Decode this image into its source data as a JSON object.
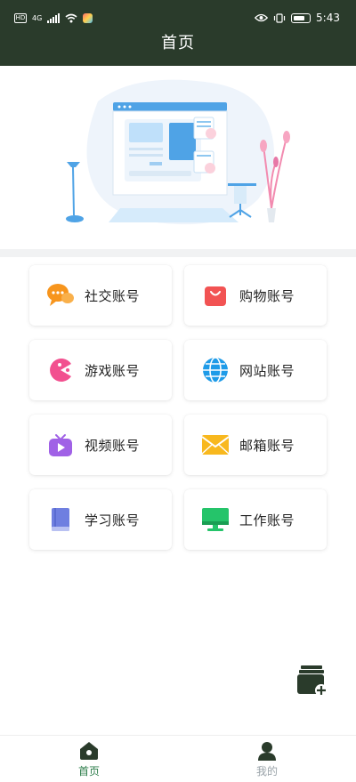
{
  "status_bar": {
    "hd": "HD",
    "network": "4G",
    "time": "5:43"
  },
  "header": {
    "title": "首页"
  },
  "categories": [
    {
      "label": "社交账号",
      "icon": "chat-bubbles-icon",
      "color": "#f7951d"
    },
    {
      "label": "购物账号",
      "icon": "shopping-bag-icon",
      "color": "#f25353"
    },
    {
      "label": "游戏账号",
      "icon": "pacman-icon",
      "color": "#f2508f"
    },
    {
      "label": "网站账号",
      "icon": "globe-icon",
      "color": "#1e9be8"
    },
    {
      "label": "视频账号",
      "icon": "tv-play-icon",
      "color": "#a061e6"
    },
    {
      "label": "邮箱账号",
      "icon": "mail-envelope-icon",
      "color": "#f8b81e"
    },
    {
      "label": "学习账号",
      "icon": "book-icon",
      "color": "#6f7fe0"
    },
    {
      "label": "工作账号",
      "icon": "monitor-icon",
      "color": "#25c46a"
    }
  ],
  "bottom_nav": {
    "home": {
      "label": "首页",
      "icon": "home-icon",
      "active": true
    },
    "me": {
      "label": "我的",
      "icon": "person-icon",
      "active": false
    }
  },
  "colors": {
    "header_bg": "#2a3b2b",
    "active": "#2d7d4b",
    "inactive": "#9aa3a9"
  }
}
